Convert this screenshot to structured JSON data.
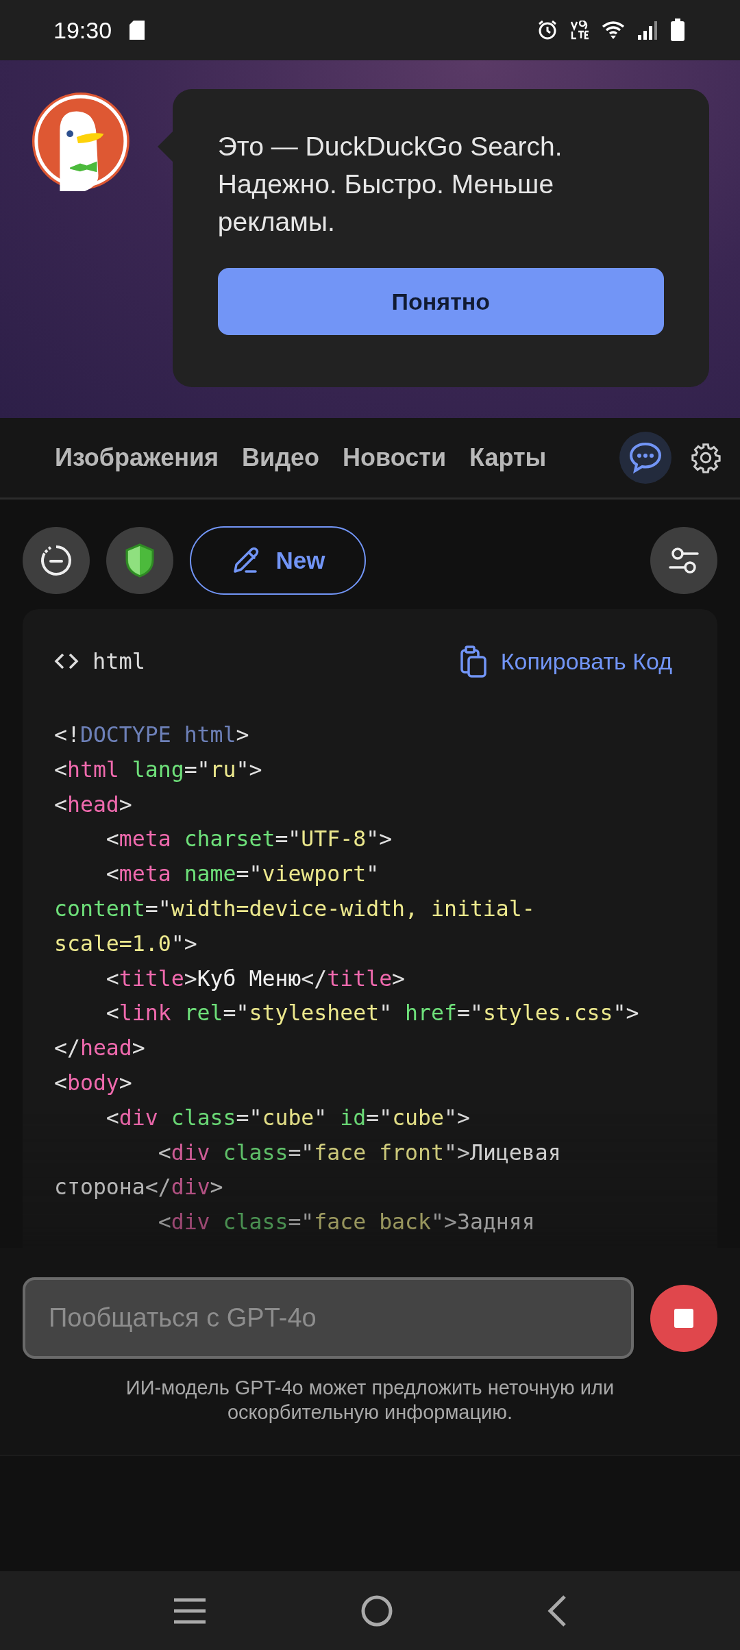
{
  "status_bar": {
    "time": "19:30"
  },
  "onboarding": {
    "message": "Это — DuckDuckGo Search. Надежно. Быстро. Меньше рекламы.",
    "button": "Понятно"
  },
  "search_tabs": {
    "tabs": [
      {
        "label": "Изображения",
        "selected": false
      },
      {
        "label": "Видео",
        "selected": false
      },
      {
        "label": "Новости",
        "selected": false
      },
      {
        "label": "Карты",
        "selected": false
      }
    ],
    "ai_chat_button": {
      "selected": true
    }
  },
  "toolbar": {
    "new_button": "New"
  },
  "code_block": {
    "language": "html",
    "copy_button": "Копировать Код",
    "lines": [
      [
        {
          "kind": "punct",
          "text": "<!"
        },
        {
          "kind": "doctype",
          "text": "DOCTYPE html"
        },
        {
          "kind": "punct",
          "text": ">"
        }
      ],
      [
        {
          "kind": "punct",
          "text": "<"
        },
        {
          "kind": "tag",
          "text": "html"
        },
        {
          "kind": "attr",
          "text": " lang"
        },
        {
          "kind": "punct",
          "text": "=\""
        },
        {
          "kind": "string",
          "text": "ru"
        },
        {
          "kind": "punct",
          "text": "\">"
        }
      ],
      [
        {
          "kind": "punct",
          "text": "<"
        },
        {
          "kind": "tag",
          "text": "head"
        },
        {
          "kind": "punct",
          "text": ">"
        }
      ],
      [
        {
          "kind": "punct",
          "text": "    <"
        },
        {
          "kind": "tag",
          "text": "meta"
        },
        {
          "kind": "attr",
          "text": " charset"
        },
        {
          "kind": "punct",
          "text": "=\""
        },
        {
          "kind": "string",
          "text": "UTF-8"
        },
        {
          "kind": "punct",
          "text": "\">"
        }
      ],
      [
        {
          "kind": "punct",
          "text": "    <"
        },
        {
          "kind": "tag",
          "text": "meta"
        },
        {
          "kind": "attr",
          "text": " name"
        },
        {
          "kind": "punct",
          "text": "=\""
        },
        {
          "kind": "string",
          "text": "viewport"
        },
        {
          "kind": "punct",
          "text": "\""
        }
      ],
      [
        {
          "kind": "attr",
          "text": "content"
        },
        {
          "kind": "punct",
          "text": "=\""
        },
        {
          "kind": "string",
          "text": "width=device-width, initial-"
        }
      ],
      [
        {
          "kind": "string",
          "text": "scale=1.0"
        },
        {
          "kind": "punct",
          "text": "\">"
        }
      ],
      [
        {
          "kind": "punct",
          "text": "    <"
        },
        {
          "kind": "tag",
          "text": "title"
        },
        {
          "kind": "punct",
          "text": ">"
        },
        {
          "kind": "text",
          "text": "Куб Меню"
        },
        {
          "kind": "punct",
          "text": "</"
        },
        {
          "kind": "tag",
          "text": "title"
        },
        {
          "kind": "punct",
          "text": ">"
        }
      ],
      [
        {
          "kind": "punct",
          "text": "    <"
        },
        {
          "kind": "tag",
          "text": "link"
        },
        {
          "kind": "attr",
          "text": " rel"
        },
        {
          "kind": "punct",
          "text": "=\""
        },
        {
          "kind": "string",
          "text": "stylesheet"
        },
        {
          "kind": "punct",
          "text": "\" "
        },
        {
          "kind": "attr",
          "text": "href"
        },
        {
          "kind": "punct",
          "text": "=\""
        },
        {
          "kind": "string",
          "text": "styles.css"
        },
        {
          "kind": "punct",
          "text": "\">"
        }
      ],
      [
        {
          "kind": "punct",
          "text": "</"
        },
        {
          "kind": "tag",
          "text": "head"
        },
        {
          "kind": "punct",
          "text": ">"
        }
      ],
      [
        {
          "kind": "punct",
          "text": "<"
        },
        {
          "kind": "tag",
          "text": "body"
        },
        {
          "kind": "punct",
          "text": ">"
        }
      ],
      [
        {
          "kind": "punct",
          "text": "    <"
        },
        {
          "kind": "tag",
          "text": "div"
        },
        {
          "kind": "attr",
          "text": " class"
        },
        {
          "kind": "punct",
          "text": "=\""
        },
        {
          "kind": "string",
          "text": "cube"
        },
        {
          "kind": "punct",
          "text": "\" "
        },
        {
          "kind": "attr",
          "text": "id"
        },
        {
          "kind": "punct",
          "text": "=\""
        },
        {
          "kind": "string",
          "text": "cube"
        },
        {
          "kind": "punct",
          "text": "\">"
        }
      ],
      [
        {
          "kind": "punct",
          "text": "        <"
        },
        {
          "kind": "tag",
          "text": "div"
        },
        {
          "kind": "attr",
          "text": " class"
        },
        {
          "kind": "punct",
          "text": "=\""
        },
        {
          "kind": "string",
          "text": "face front"
        },
        {
          "kind": "punct",
          "text": "\">"
        },
        {
          "kind": "text",
          "text": "Лицевая"
        }
      ],
      [
        {
          "kind": "text",
          "text": "сторона"
        },
        {
          "kind": "punct",
          "text": "</"
        },
        {
          "kind": "tag",
          "text": "div"
        },
        {
          "kind": "punct",
          "text": ">"
        }
      ],
      [
        {
          "kind": "punct",
          "text": "        <"
        },
        {
          "kind": "tag",
          "text": "div"
        },
        {
          "kind": "attr",
          "text": " class"
        },
        {
          "kind": "punct",
          "text": "=\""
        },
        {
          "kind": "string",
          "text": "face back"
        },
        {
          "kind": "punct",
          "text": "\">"
        },
        {
          "kind": "text",
          "text": "Задняя"
        }
      ]
    ]
  },
  "chat_input": {
    "placeholder": "Пообщаться с GPT-4o"
  },
  "disclaimer": "ИИ-модель GPT-4o может предложить неточную или оскорбительную информацию."
}
